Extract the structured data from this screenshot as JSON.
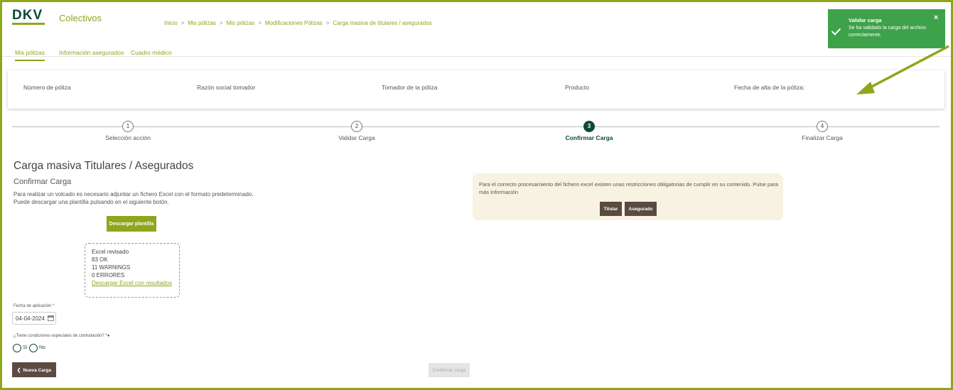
{
  "header": {
    "logo": "DKV",
    "app_name": "Colectivos",
    "breadcrumb": [
      "Inicio",
      "Mis pólizas",
      "Mis pólizas",
      "Modificaciones Pólizas",
      "Carga masiva de titulares / asegurados"
    ],
    "breadcrumb_sep": ">"
  },
  "nav": {
    "tabs": [
      {
        "label": "Mis pólizas",
        "active": true
      },
      {
        "label": "Información asegurados",
        "active": false
      },
      {
        "label": "Cuadro médico",
        "active": false
      }
    ]
  },
  "policy": {
    "columns": [
      "Número de póliza",
      "Razón social tomador",
      "Tomador de la póliza",
      "Producto",
      "Fecha de alta de la póliza:"
    ]
  },
  "stepper": {
    "steps": [
      {
        "num": "1",
        "label": "Selección acción",
        "active": false
      },
      {
        "num": "2",
        "label": "Validar Carga",
        "active": false
      },
      {
        "num": "3",
        "label": "Confirmar Carga",
        "active": true
      },
      {
        "num": "4",
        "label": "Finalizar Carga",
        "active": false
      }
    ]
  },
  "main": {
    "title": "Carga masiva Titulares / Asegurados",
    "subtitle": "Confirmar Carga",
    "desc_line1": "Para realizar un volcado es necesario adjuntar un fichero Excel con el formato predeterminado.",
    "desc_line2": "Puede descargar una plantilla pulsando en el siguiente botón.",
    "download_template": "Descargar plantilla",
    "result": {
      "title": "Excel revisado",
      "ok": "83 OK",
      "warnings": "11 WARNINGS",
      "errors": "0 ERRORES",
      "link": "Descargar Excel con resultados"
    },
    "date_label": "Fecha de aplicación *",
    "date_value": "04-04-2024",
    "conditions_label": "¿Tiene condiciones especiales de contratación? *",
    "radio_yes": "Sí",
    "radio_no": "No",
    "new_load": "Nueva Carga",
    "confirm_load": "Confirmar carga"
  },
  "info": {
    "text": "Para el correcto procesamiento del fichero excel existen unas restricciones obligatorias de cumplir en su contenido. Pulse para más información",
    "btn_titular": "Titular",
    "btn_asegurado": "Asegurado"
  },
  "toast": {
    "title": "Validar carga",
    "message": "Se ha validado la carga del archivo correctamente.",
    "close": "×"
  },
  "colors": {
    "brand_green": "#8fa51c",
    "dark_green": "#0b4a3c",
    "toast_green": "#3ea24a",
    "brown": "#5a4a42",
    "info_bg": "#f8f2e2"
  }
}
